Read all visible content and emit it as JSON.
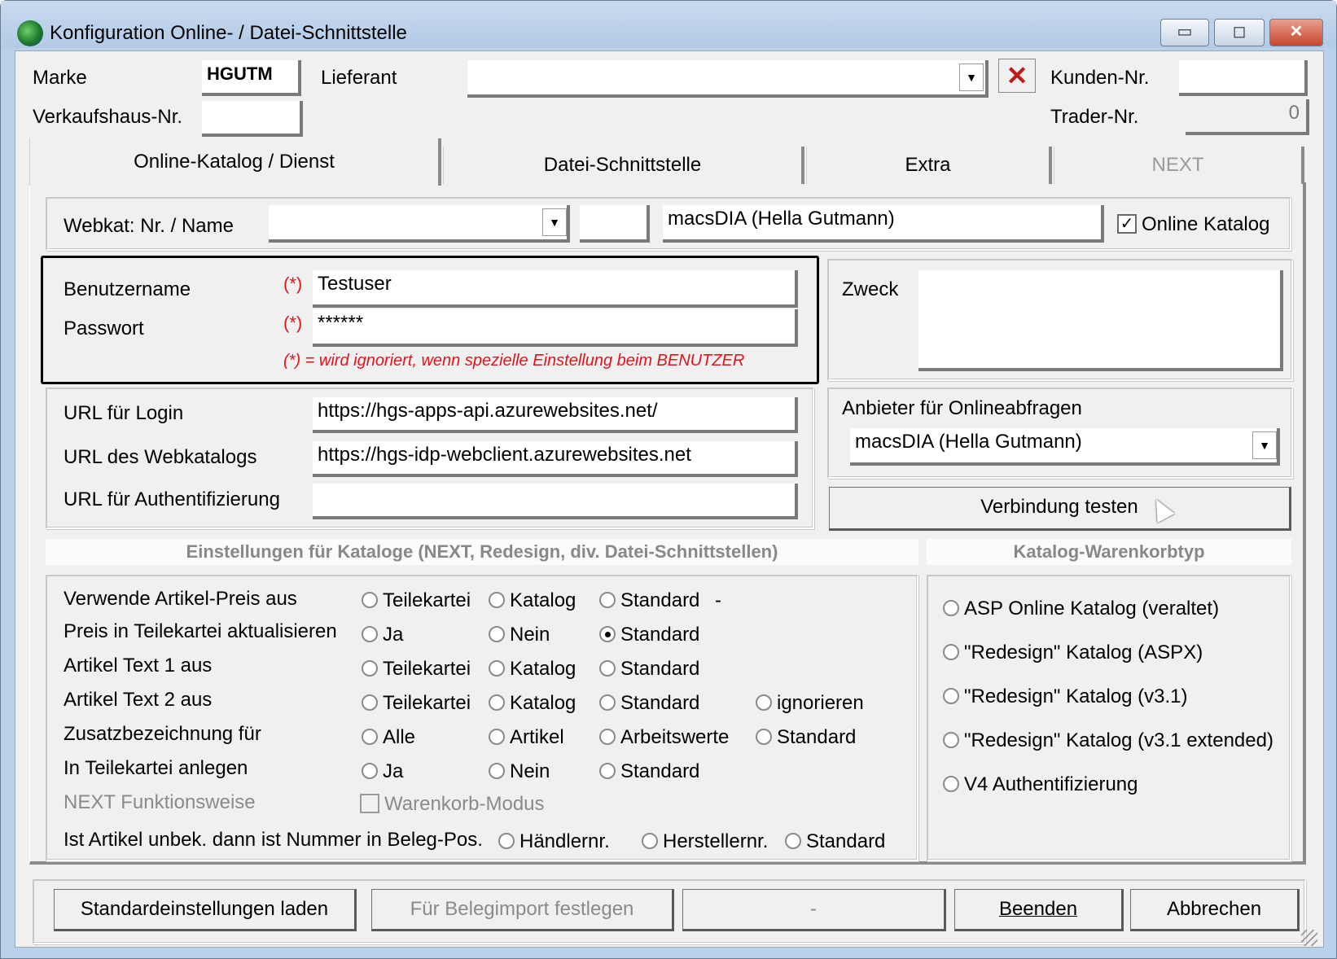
{
  "window": {
    "title": "Konfiguration Online- / Datei-Schnittstelle",
    "minimize_glyph": "▭",
    "maximize_glyph": "◻",
    "close_glyph": "✕"
  },
  "header": {
    "marke_label": "Marke",
    "marke_value": "HGUTM",
    "lieferant_label": "Lieferant",
    "lieferant_value": "",
    "kunden_nr_label": "Kunden-Nr.",
    "kunden_nr_value": "",
    "verkaufshaus_label": "Verkaufshaus-Nr.",
    "verkaufshaus_value": "",
    "trader_nr_label": "Trader-Nr.",
    "trader_nr_value": "0",
    "clear_glyph": "✕"
  },
  "tabs": [
    {
      "label": "Online-Katalog / Dienst",
      "active": true
    },
    {
      "label": "Datei-Schnittstelle",
      "active": false
    },
    {
      "label": "Extra",
      "active": false
    },
    {
      "label": "NEXT",
      "active": false,
      "disabled": true
    }
  ],
  "webkat": {
    "label": "Webkat: Nr. / Name",
    "nr_value": "",
    "short_value": "",
    "name_value": "macsDIA (Hella Gutmann)",
    "online_katalog_label": "Online Katalog",
    "online_katalog_checked": true
  },
  "credentials": {
    "benutzername_label": "Benutzername",
    "benutzername_value": "Testuser",
    "passwort_label": "Passwort",
    "passwort_value": "******",
    "required_mark": "(*)",
    "note": "(*) = wird ignoriert, wenn spezielle Einstellung beim BENUTZER"
  },
  "zweck": {
    "label": "Zweck",
    "value": ""
  },
  "urls": {
    "login_label": "URL für Login",
    "login_value": "https://hgs-apps-api.azurewebsites.net/",
    "webkatalog_label": "URL des Webkatalogs",
    "webkatalog_value": "https://hgs-idp-webclient.azurewebsites.net",
    "auth_label": "URL für Authentifizierung",
    "auth_value": ""
  },
  "anbieter": {
    "label": "Anbieter für Onlineabfragen",
    "value": "macsDIA (Hella Gutmann)"
  },
  "verbindung_button": "Verbindung testen",
  "settings": {
    "header": "Einstellungen für Kataloge (NEXT, Redesign, div. Datei-Schnittstellen)",
    "rows": [
      {
        "label": "Verwende Artikel-Preis aus",
        "options": [
          "Teilekartei",
          "Katalog",
          "Standard"
        ],
        "suffix": "-"
      },
      {
        "label": "Preis in Teilekartei aktualisieren",
        "options": [
          "Ja",
          "Nein",
          "Standard"
        ]
      },
      {
        "label": "Artikel Text 1 aus",
        "options": [
          "Teilekartei",
          "Katalog",
          "Standard"
        ]
      },
      {
        "label": "Artikel Text 2 aus",
        "options": [
          "Teilekartei",
          "Katalog",
          "Standard",
          "ignorieren"
        ]
      },
      {
        "label": "Zusatzbezeichnung für",
        "options": [
          "Alle",
          "Artikel",
          "Arbeitswerte",
          "Standard"
        ]
      },
      {
        "label": "In Teilekartei anlegen",
        "options": [
          "Ja",
          "Nein",
          "Standard"
        ]
      }
    ],
    "next_label": "NEXT Funktionsweise",
    "warenkorb_label": "Warenkorb-Modus",
    "unbek_label": "Ist Artikel unbek. dann ist Nummer in Beleg-Pos.",
    "unbek_options": [
      "Händlernr.",
      "Herstellernr.",
      "Standard"
    ]
  },
  "warenkorb": {
    "header": "Katalog-Warenkorbtyp",
    "options": [
      "ASP Online Katalog (veraltet)",
      "\"Redesign\" Katalog (ASPX)",
      "\"Redesign\" Katalog (v3.1)",
      "\"Redesign\" Katalog (v3.1 extended)",
      "V4 Authentifizierung"
    ]
  },
  "footer": {
    "standard_button": "Standardeinstellungen laden",
    "belegimport_button": "Für Belegimport festlegen",
    "dash_button": "-",
    "beenden_button": "Beenden",
    "abbrechen_button": "Abbrechen"
  }
}
